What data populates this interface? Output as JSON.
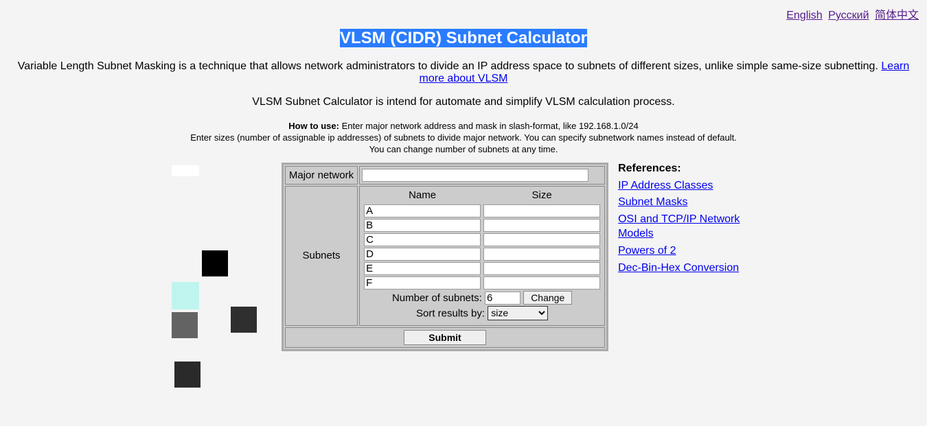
{
  "langs": {
    "en": "English",
    "ru": "Русский",
    "cn": "简体中文"
  },
  "title": "VLSM (CIDR) Subnet Calculator",
  "intro_1": "Variable Length Subnet Masking is a technique that allows network administrators to divide an IP address space to subnets of different sizes, unlike simple same-size subnetting. ",
  "intro_link": "Learn more about VLSM",
  "subtitle": "VLSM Subnet Calculator is intend for automate and simplify VLSM calculation process.",
  "howto_label": "How to use:",
  "howto_1": " Enter major network address and mask in slash-format, like 192.168.1.0/24",
  "howto_2": "Enter sizes (number of assignable ip addresses) of subnets to divide major network. You can specify subnetwork names instead of default.",
  "howto_3": "You can change number of subnets at any time.",
  "form": {
    "major_label": "Major network",
    "major_value": "",
    "subnets_label": "Subnets",
    "name_header": "Name",
    "size_header": "Size",
    "rows": [
      {
        "name": "A",
        "size": ""
      },
      {
        "name": "B",
        "size": ""
      },
      {
        "name": "C",
        "size": ""
      },
      {
        "name": "D",
        "size": ""
      },
      {
        "name": "E",
        "size": ""
      },
      {
        "name": "F",
        "size": ""
      }
    ],
    "num_label": "Number of subnets:",
    "num_value": "6",
    "change_btn": "Change",
    "sort_label": "Sort results by:",
    "sort_value": "size",
    "submit": "Submit"
  },
  "refs_title": "References:",
  "refs": [
    "IP Address Classes",
    "Subnet Masks",
    "OSI and TCP/IP Network Models",
    "Powers of 2",
    "Dec-Bin-Hex Conversion"
  ]
}
